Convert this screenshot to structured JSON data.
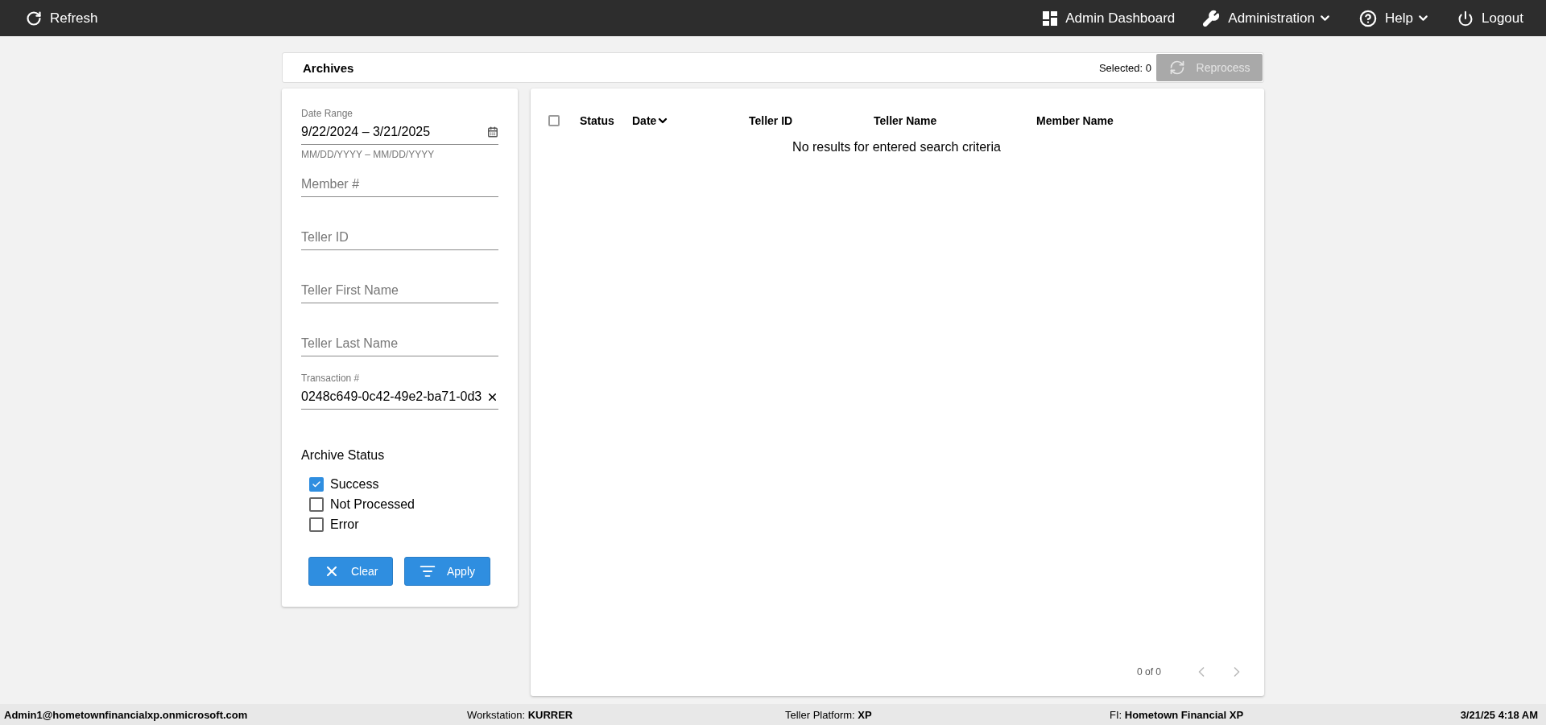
{
  "top_bar": {
    "left": [
      {
        "kind": "refresh",
        "label": "Refresh"
      }
    ],
    "right": [
      {
        "kind": "dashboard",
        "label": "Admin Dashboard",
        "dropdown": false
      },
      {
        "kind": "wrench",
        "label": "Administration",
        "dropdown": true
      },
      {
        "kind": "help",
        "label": "Help",
        "dropdown": true
      },
      {
        "kind": "power",
        "label": "Logout",
        "dropdown": false
      }
    ]
  },
  "header": {
    "title": "Archives",
    "selected_count": "Selected: 0",
    "reprocess_button": {
      "label": "Reprocess",
      "disabled": true
    }
  },
  "filters": {
    "fields": [
      {
        "kind": "date",
        "label": "Date Range",
        "value": "9/22/2024 – 3/21/2025",
        "helper": "MM/DD/YYYY – MM/DD/YYYY"
      },
      {
        "kind": "text",
        "placeholder": "Member #"
      },
      {
        "kind": "text",
        "placeholder": "Teller ID"
      },
      {
        "kind": "text",
        "placeholder": "Teller First Name"
      },
      {
        "kind": "text",
        "placeholder": "Teller Last Name"
      },
      {
        "kind": "text",
        "label": "Transaction #",
        "value": "0248c649-0c42-49e2-ba71-0d3",
        "clearable": true
      }
    ],
    "status_title": "Archive Status",
    "statuses": [
      {
        "label": "Success",
        "checked": true
      },
      {
        "label": "Not Processed",
        "checked": false
      },
      {
        "label": "Error",
        "checked": false
      }
    ],
    "buttons": [
      {
        "kind": "clear",
        "label": "Clear"
      },
      {
        "kind": "apply",
        "label": "Apply"
      }
    ]
  },
  "table": {
    "select_all_checked": false,
    "columns": [
      {
        "label": "Status",
        "sorted": false
      },
      {
        "label": "Date",
        "sorted": true
      },
      {
        "label": "Teller ID",
        "sorted": false
      },
      {
        "label": "Teller Name",
        "sorted": false
      },
      {
        "label": "Member Name",
        "sorted": false
      }
    ],
    "empty_message": "No results for entered search criteria",
    "pagination": {
      "range": "0 of 0",
      "prev_disabled": true,
      "next_disabled": true
    }
  },
  "status_bar": {
    "user": "Admin1@hometownfinancialxp.onmicrosoft.com",
    "items": [
      "Workstation: **KURRER**",
      "Teller Platform: **XP**",
      "FI: **Hometown Financial XP**"
    ],
    "time": "3/21/25 4:18 AM"
  }
}
